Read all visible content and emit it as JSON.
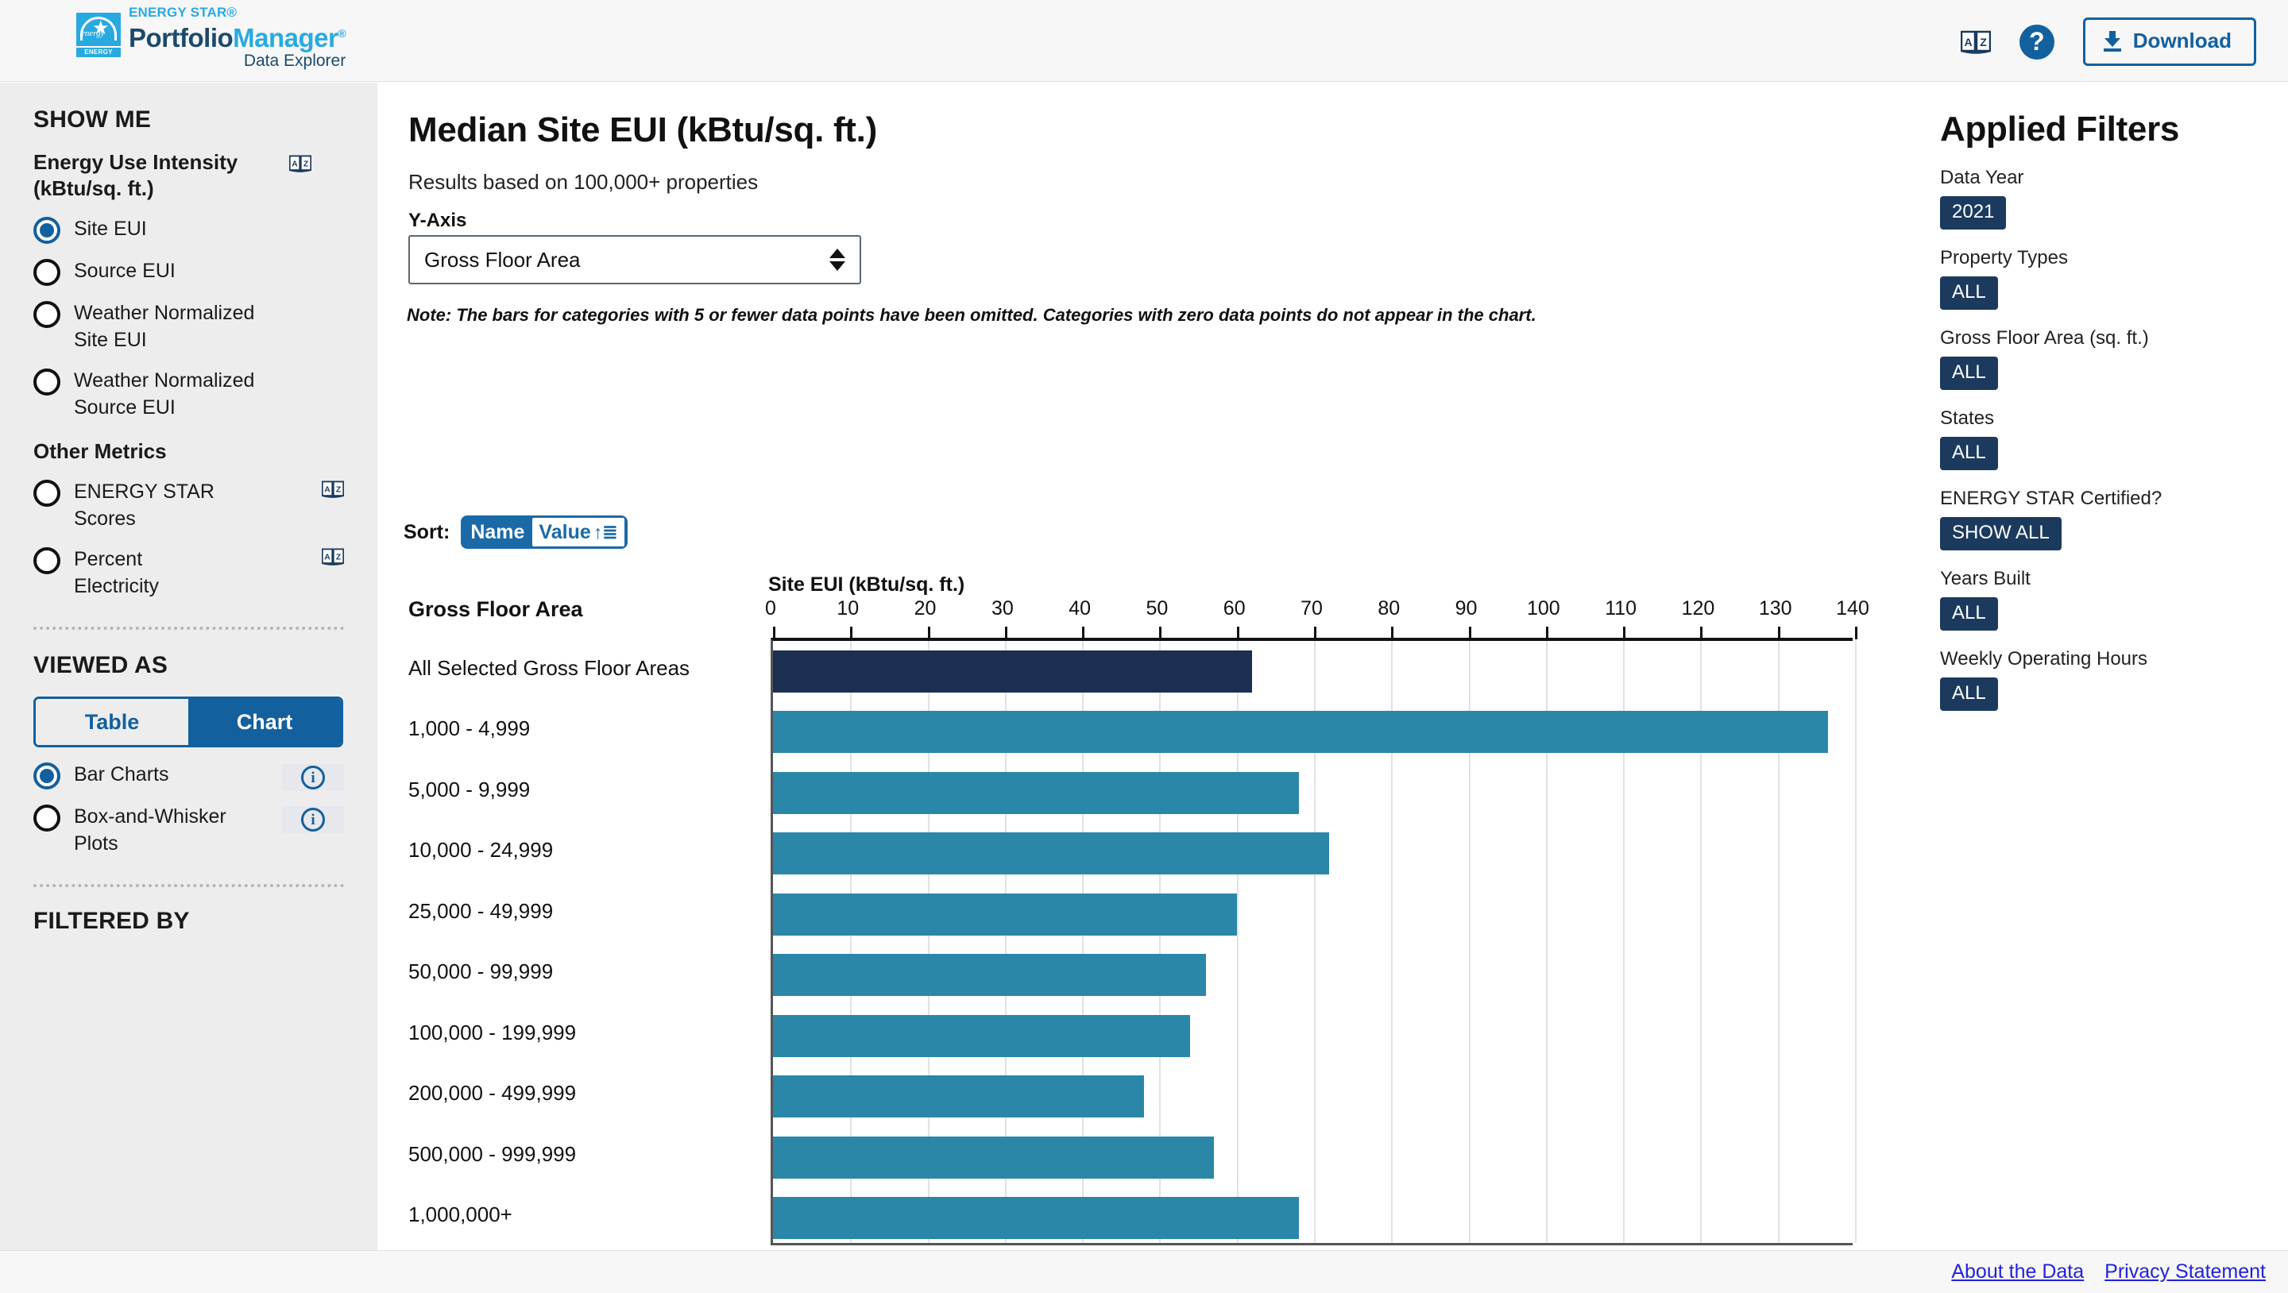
{
  "header": {
    "brand_line1": "ENERGY STAR",
    "brand_reg1": "®",
    "brand_portfolio": "Portfolio",
    "brand_manager": "Manager",
    "brand_reg2": "®",
    "brand_line3": "Data Explorer",
    "mark_band": "ENERGY STAR",
    "glossary_icon": "az-book-icon",
    "help_icon": "help-question-icon",
    "download_label": "Download"
  },
  "sidebar": {
    "show_me_title": "SHOW ME",
    "group1_title": "Energy Use Intensity (kBtu/sq. ft.)",
    "metrics": [
      {
        "label": "Site EUI",
        "selected": true
      },
      {
        "label": "Source EUI",
        "selected": false
      },
      {
        "label": "Weather Normalized Site EUI",
        "selected": false
      },
      {
        "label": "Weather Normalized Source EUI",
        "selected": false
      }
    ],
    "group2_title": "Other Metrics",
    "other_metrics": [
      {
        "label": "ENERGY STAR Scores",
        "selected": false
      },
      {
        "label": "Percent Electricity",
        "selected": false
      }
    ],
    "viewed_as_title": "VIEWED AS",
    "view_table": "Table",
    "view_chart": "Chart",
    "view_selected": "Chart",
    "chart_types": [
      {
        "label": "Bar Charts",
        "selected": true
      },
      {
        "label": "Box-and-Whisker Plots",
        "selected": false
      }
    ],
    "filtered_by_title": "FILTERED BY"
  },
  "main": {
    "title": "Median Site EUI (kBtu/sq. ft.)",
    "subtitle": "Results based on 100,000+ properties",
    "yaxis_label": "Y-Axis",
    "yaxis_value": "Gross Floor Area",
    "note": "Note: The bars for categories with 5 or fewer data points have been omitted. Categories with zero data points do not appear in the chart.",
    "sort_label": "Sort:",
    "sort_name": "Name",
    "sort_value": "Value",
    "sort_direction_icon": "sort-ascending-icon"
  },
  "chart_data": {
    "type": "bar",
    "orientation": "horizontal",
    "title": "Median Site EUI (kBtu/sq. ft.)",
    "subtitle": "Results based on 100,000+ properties",
    "xlabel": "Site EUI (kBtu/sq. ft.)",
    "ylabel": "Gross Floor Area",
    "xlim": [
      0,
      140
    ],
    "xticks": [
      0,
      10,
      20,
      30,
      40,
      50,
      60,
      70,
      80,
      90,
      100,
      110,
      120,
      130,
      140
    ],
    "grid": true,
    "legend": "none",
    "categories": [
      "All Selected Gross Floor Areas",
      "1,000 - 4,999",
      "5,000 - 9,999",
      "10,000 - 24,999",
      "25,000 - 49,999",
      "50,000 - 99,999",
      "100,000 - 199,999",
      "200,000 - 499,999",
      "500,000 - 999,999",
      "1,000,000+"
    ],
    "values": [
      62,
      136.5,
      68,
      72,
      60,
      56,
      54,
      48,
      57,
      68
    ],
    "colors": {
      "total_bar": "#1b2f51",
      "category_bar": "#2b87a8"
    }
  },
  "filters": {
    "title": "Applied Filters",
    "items": [
      {
        "label": "Data Year",
        "value": "2021"
      },
      {
        "label": "Property Types",
        "value": "ALL"
      },
      {
        "label": "Gross Floor Area (sq. ft.)",
        "value": "ALL"
      },
      {
        "label": "States",
        "value": "ALL"
      },
      {
        "label": "ENERGY STAR Certified?",
        "value": "SHOW ALL"
      },
      {
        "label": "Years Built",
        "value": "ALL"
      },
      {
        "label": "Weekly Operating Hours",
        "value": "ALL"
      }
    ]
  },
  "footer": {
    "about_link": "About the Data",
    "privacy_link": "Privacy Statement"
  }
}
